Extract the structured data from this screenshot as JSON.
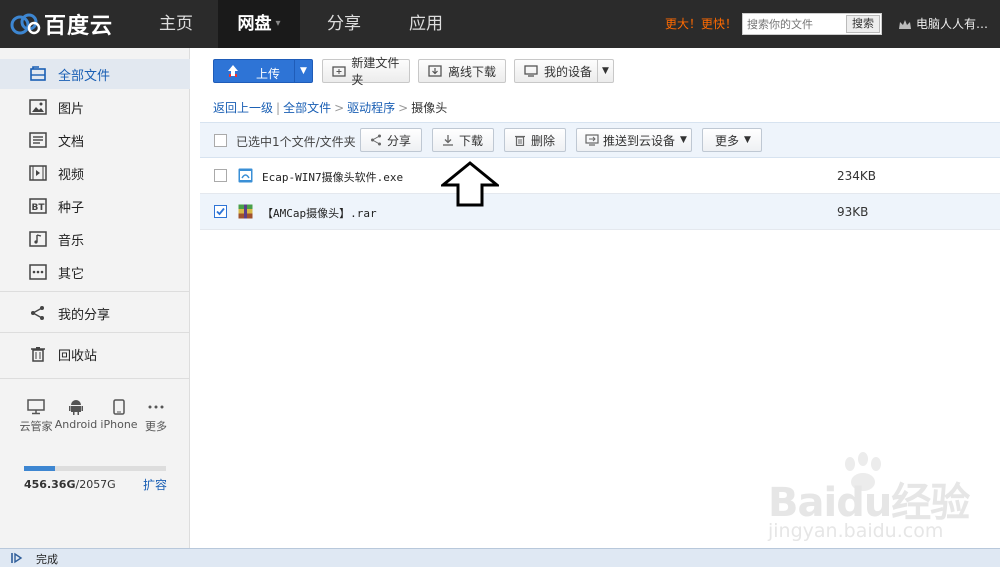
{
  "topbar": {
    "logo_text": "百度云",
    "nav": [
      {
        "label": "主页",
        "active": false
      },
      {
        "label": "网盘",
        "active": true,
        "has_caret": true
      },
      {
        "label": "分享",
        "active": false
      },
      {
        "label": "应用",
        "active": false
      }
    ],
    "promo": "更大！更快！",
    "search_placeholder": "搜索你的文件",
    "search_button": "搜索",
    "user_name": "电脑人人有…"
  },
  "sidebar": {
    "items": [
      {
        "label": "全部文件",
        "icon": "folder-icon",
        "active": true
      },
      {
        "label": "图片",
        "icon": "image-icon"
      },
      {
        "label": "文档",
        "icon": "document-icon"
      },
      {
        "label": "视频",
        "icon": "video-icon"
      },
      {
        "label": "种子",
        "icon": "bt-icon"
      },
      {
        "label": "音乐",
        "icon": "music-icon"
      },
      {
        "label": "其它",
        "icon": "more-dots-icon"
      },
      {
        "label": "我的分享",
        "icon": "share-icon"
      },
      {
        "label": "回收站",
        "icon": "trash-icon"
      }
    ],
    "devices": [
      {
        "label": "云管家",
        "icon": "desktop-icon"
      },
      {
        "label": "Android",
        "icon": "android-icon"
      },
      {
        "label": "iPhone",
        "icon": "iphone-icon"
      },
      {
        "label": "更多",
        "icon": "more-dots-icon"
      }
    ],
    "quota": {
      "used": "456.36G",
      "total": "/2057G",
      "used_fraction": 0.22
    },
    "expand": "扩容"
  },
  "toolbar": {
    "upload": "上传",
    "new_folder": "新建文件夹",
    "offline_download": "离线下载",
    "my_devices": "我的设备"
  },
  "breadcrumb": {
    "back": "返回上一级",
    "all_files": "全部文件",
    "driver": "驱动程序",
    "current": "摄像头"
  },
  "actionbar": {
    "selected_text": "已选中1个文件/文件夹",
    "share": "分享",
    "download": "下载",
    "delete": "删除",
    "push_to_device": "推送到云设备",
    "more": "更多"
  },
  "files": [
    {
      "name": "Ecap-WIN7摄像头软件.exe",
      "size": "234KB",
      "checked": false,
      "icon": "exe-file-icon"
    },
    {
      "name": "【AMCap摄像头】.rar",
      "size": "93KB",
      "checked": true,
      "icon": "rar-file-icon"
    }
  ],
  "watermark": {
    "main": "Baidu经验",
    "sub": "jingyan.baidu.com"
  },
  "status": {
    "text": "完成"
  },
  "colors": {
    "topbar": "#2b2b2b",
    "accent": "#2e74d6",
    "promo": "#ff6a00",
    "link": "#1a5fb4"
  }
}
